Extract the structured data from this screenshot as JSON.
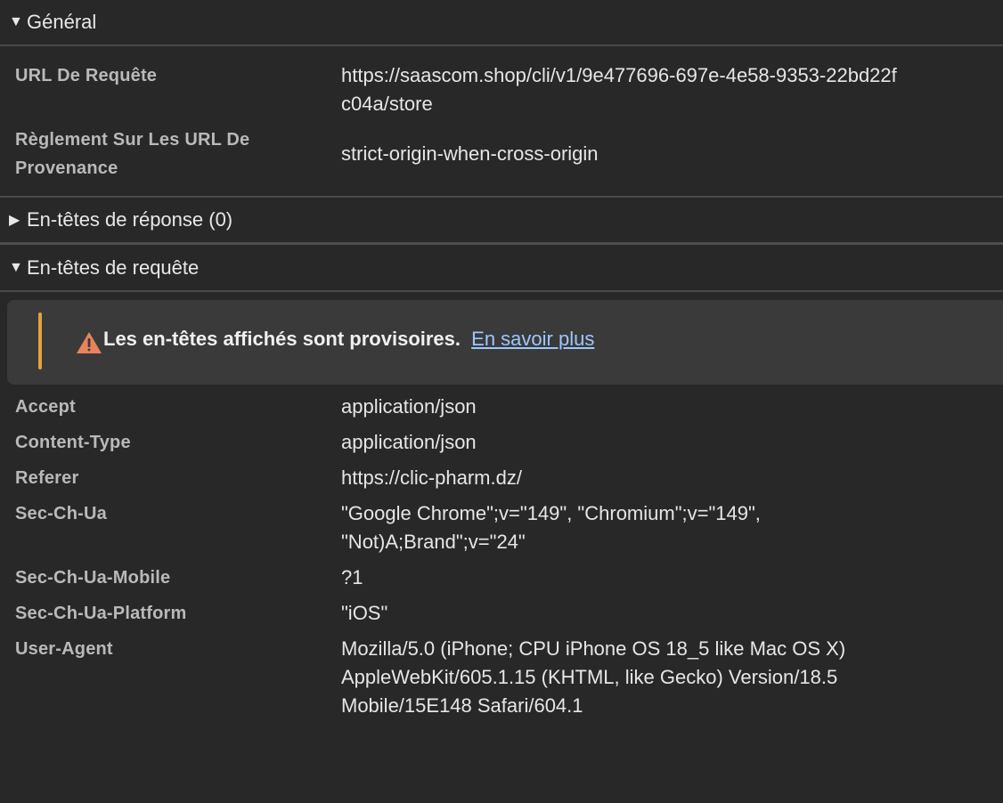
{
  "sections": {
    "general": {
      "title": "Général",
      "expanded": true,
      "rows": [
        {
          "key": "URL De Requête",
          "value": "https://saascom.shop/cli/v1/9e477696-697e-4e58-9353-22bd22f\nc04a/store"
        },
        {
          "key": "Règlement Sur Les URL De\nProvenance",
          "value": "strict-origin-when-cross-origin"
        }
      ]
    },
    "response_headers": {
      "title": "En-têtes de réponse (0)",
      "expanded": false
    },
    "request_headers": {
      "title": "En-têtes de requête",
      "expanded": true,
      "warning": {
        "message": "Les en-têtes affichés sont provisoires.",
        "link": "En savoir plus"
      },
      "rows": [
        {
          "key": "Accept",
          "value": "application/json"
        },
        {
          "key": "Content-Type",
          "value": "application/json"
        },
        {
          "key": "Referer",
          "value": "https://clic-pharm.dz/"
        },
        {
          "key": "Sec-Ch-Ua",
          "value": "\"Google Chrome\";v=\"149\", \"Chromium\";v=\"149\",\n\"Not)A;Brand\";v=\"24\""
        },
        {
          "key": "Sec-Ch-Ua-Mobile",
          "value": "?1"
        },
        {
          "key": "Sec-Ch-Ua-Platform",
          "value": "\"iOS\""
        },
        {
          "key": "User-Agent",
          "value": "Mozilla/5.0 (iPhone; CPU iPhone OS 18_5 like Mac OS X)\nAppleWebKit/605.1.15 (KHTML, like Gecko) Version/18.5\nMobile/15E148 Safari/604.1"
        }
      ]
    }
  },
  "icons": {
    "expanded": "triangle-down-icon",
    "collapsed": "triangle-right-icon",
    "warning": "warning-icon"
  },
  "colors": {
    "background": "#282828",
    "banner": "#3a3a3a",
    "warning_accent": "#e0a33c",
    "link": "#9ec7ff"
  }
}
